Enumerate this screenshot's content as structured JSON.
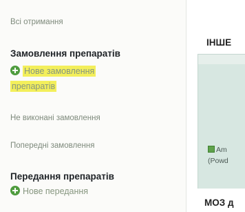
{
  "sidebar": {
    "all_received": "Всі отримання",
    "orders_heading": "Замовлення препаратів",
    "new_order_line1": "Нове замовлення",
    "new_order_line2": "препаратів",
    "not_completed": "Не виконані замовлення",
    "previous_orders": "Попередні замовлення",
    "transfer_heading": "Передання препаратів",
    "new_transfer": "Нове передання"
  },
  "main": {
    "other_heading": "ІНШЕ",
    "drug_line1": "Am",
    "drug_line2": "(Powd",
    "moz_heading": "МОЗ д"
  },
  "colors": {
    "highlight": "#f3ef5b",
    "plus_icon": "#4f9c3e",
    "panel": "#d7e7e1"
  }
}
